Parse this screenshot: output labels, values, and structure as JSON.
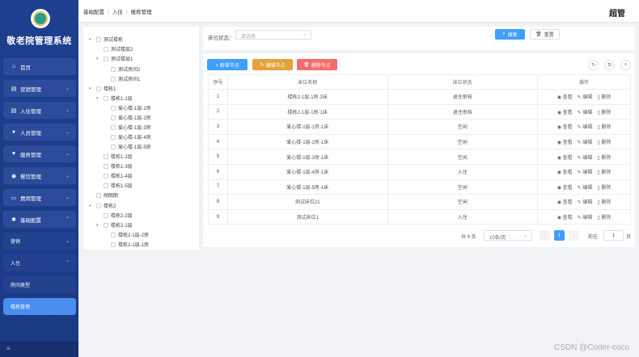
{
  "sidebar": {
    "title": "敬老院管理系统",
    "items": [
      {
        "label": "首页",
        "icon": "home-icon"
      },
      {
        "label": "营销管理",
        "icon": "document-icon"
      },
      {
        "label": "入住管理",
        "icon": "document-icon"
      },
      {
        "label": "人员管理",
        "icon": "user-icon"
      },
      {
        "label": "服务管理",
        "icon": "heart-icon"
      },
      {
        "label": "餐饮管理",
        "icon": "food-icon"
      },
      {
        "label": "费用管理",
        "icon": "money-icon"
      },
      {
        "label": "基础配置",
        "icon": "gear-icon"
      }
    ],
    "sub_items": [
      {
        "label": "营销"
      },
      {
        "label": "入住"
      },
      {
        "label": "房间类型"
      },
      {
        "label": "楼栋管理"
      }
    ]
  },
  "header": {
    "breadcrumb": [
      "基础配置",
      "入住",
      "楼栋管理"
    ],
    "user": "超管"
  },
  "tree": [
    {
      "label": "测试楼栋",
      "arrow": "▾"
    },
    {
      "label": "测试楼层2",
      "arrow": ""
    },
    {
      "label": "测试楼层1",
      "arrow": "▾"
    },
    {
      "label": "测试房间2",
      "arrow": ""
    },
    {
      "label": "测试房间1",
      "arrow": ""
    },
    {
      "label": "楼栋1",
      "arrow": "▾"
    },
    {
      "label": "楼栋1-1层",
      "arrow": "▾"
    },
    {
      "label": "爱心楼-1层-1房",
      "arrow": ""
    },
    {
      "label": "爱心楼-1层-2房",
      "arrow": ""
    },
    {
      "label": "爱心楼-1层-3房",
      "arrow": ""
    },
    {
      "label": "爱心楼-1层-4房",
      "arrow": ""
    },
    {
      "label": "爱心楼-1层-5房",
      "arrow": ""
    },
    {
      "label": "楼栋1-2层",
      "arrow": ""
    },
    {
      "label": "楼栋1-3层",
      "arrow": ""
    },
    {
      "label": "楼栋1-4层",
      "arrow": ""
    },
    {
      "label": "楼栋1-5层",
      "arrow": ""
    },
    {
      "label": "胡朗朗",
      "arrow": ""
    },
    {
      "label": "楼栋2",
      "arrow": "▾"
    },
    {
      "label": "楼栋2-2层",
      "arrow": ""
    },
    {
      "label": "楼栋2-1层",
      "arrow": "▾"
    },
    {
      "label": "楼栋2-1层-2房",
      "arrow": ""
    },
    {
      "label": "楼栋2-1层-1房",
      "arrow": ""
    }
  ],
  "search": {
    "label": "床位状态：",
    "placeholder": "请选择",
    "search_label": "搜索",
    "reset_label": "重置"
  },
  "toolbar": {
    "add_label": "+ 新增节点",
    "edit_label": "编辑节点",
    "delete_label": "删除节点"
  },
  "table": {
    "headers": [
      "序号",
      "床位名称",
      "床位状态",
      "操作"
    ],
    "ops": [
      "查看",
      "编辑",
      "删除"
    ],
    "rows": [
      {
        "no": "1",
        "name": "楼栋2-1层-1房-2床",
        "status": "退住审核"
      },
      {
        "no": "2",
        "name": "楼栋2-1层-1房-1床",
        "status": "退住审核"
      },
      {
        "no": "3",
        "name": "爱心楼-1层-1房-1床",
        "status": "空闲"
      },
      {
        "no": "4",
        "name": "爱心楼-1层-2房-1床",
        "status": "空闲"
      },
      {
        "no": "5",
        "name": "爱心楼-1层-3房-1床",
        "status": "空闲"
      },
      {
        "no": "6",
        "name": "爱心楼-1层-4房-1床",
        "status": "入住"
      },
      {
        "no": "7",
        "name": "爱心楼-1层-5房-1床",
        "status": "空闲"
      },
      {
        "no": "8",
        "name": "测试床位21",
        "status": "空闲"
      },
      {
        "no": "9",
        "name": "测试床位1",
        "status": "入住"
      }
    ]
  },
  "pagination": {
    "total": "共 9 条",
    "page_size": "10条/页",
    "current": "1",
    "goto_label": "前往",
    "goto_value": "1",
    "page_suffix": "页"
  },
  "watermark": "CSDN @Coder-coco",
  "colors": {
    "primary": "#409eff",
    "warning": "#e6a23c",
    "danger": "#f56c6c",
    "sidebar": "#1e3f8f"
  }
}
